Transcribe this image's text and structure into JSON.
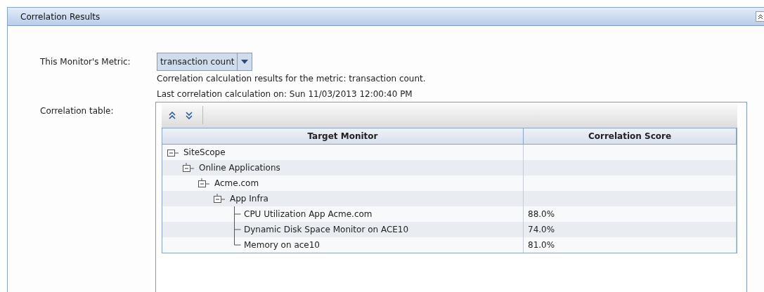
{
  "panel": {
    "title": "Correlation Results"
  },
  "metric": {
    "label": "This Monitor's Metric:",
    "value": "transaction count"
  },
  "info_lines": [
    "Correlation calculation results for the metric: transaction count.",
    "Last correlation calculation on: Sun 11/03/2013 12:00:40 PM"
  ],
  "table": {
    "label": "Correlation table:",
    "columns": [
      "Target Monitor",
      "Correlation Score"
    ],
    "rows": [
      {
        "name": "SiteScope",
        "expanded": true,
        "children": [
          {
            "name": "Online Applications",
            "expanded": true,
            "children": [
              {
                "name": "Acme.com",
                "expanded": true,
                "children": [
                  {
                    "name": "App Infra",
                    "expanded": true,
                    "children": [
                      {
                        "name": "CPU Utilization App Acme.com",
                        "score": "88.0%"
                      },
                      {
                        "name": "Dynamic Disk Space Monitor on ACE10",
                        "score": "74.0%"
                      },
                      {
                        "name": "Memory on ace10",
                        "score": "81.0%"
                      }
                    ]
                  }
                ]
              }
            ]
          }
        ]
      }
    ]
  }
}
